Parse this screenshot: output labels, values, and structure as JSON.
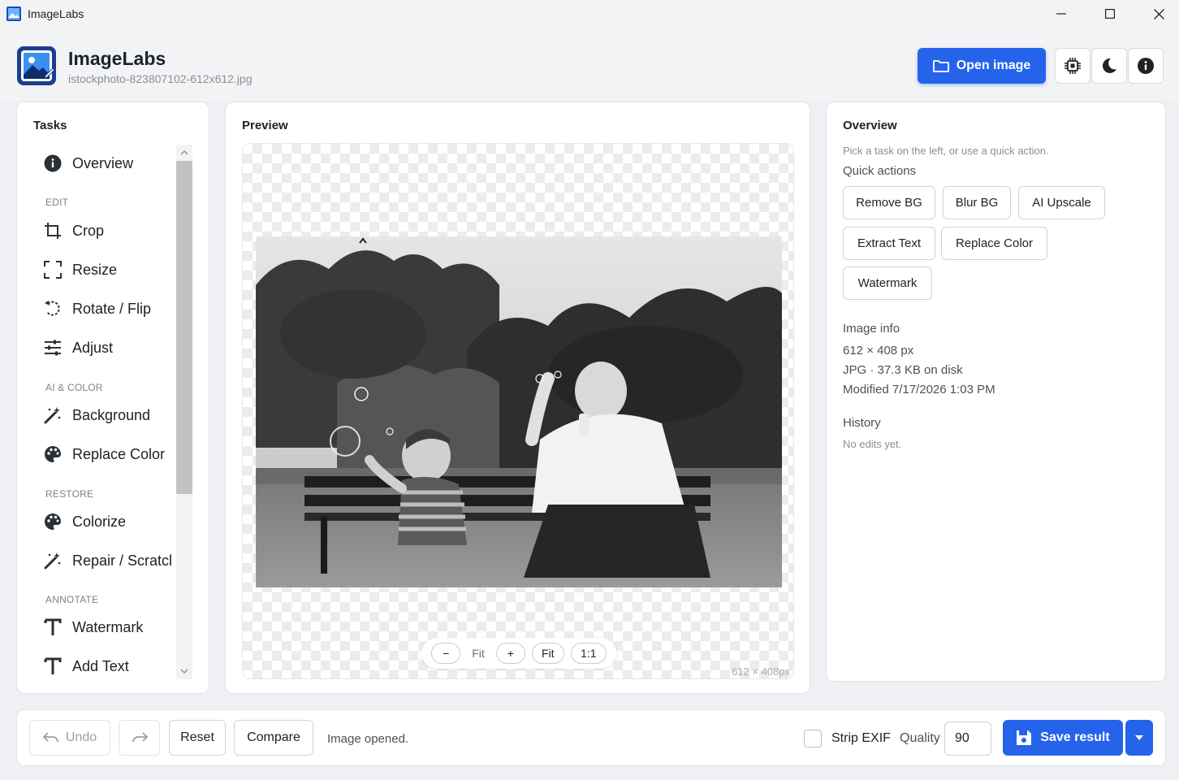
{
  "window": {
    "title": "ImageLabs",
    "controls": [
      "minimize-icon",
      "maximize-icon",
      "close-icon"
    ]
  },
  "header": {
    "app_name": "ImageLabs",
    "file_name": "istockphoto-823807102-612x612.jpg",
    "open_button": "Open image",
    "icon_buttons": [
      "cpu-icon",
      "dark-mode-icon",
      "info-icon"
    ],
    "accent_color": "#2563eb"
  },
  "tasks": {
    "title": "Tasks",
    "overview_item": {
      "label": "Overview",
      "icon": "info-icon"
    },
    "sections": [
      {
        "label": "EDIT",
        "items": [
          {
            "label": "Crop",
            "icon": "crop-icon"
          },
          {
            "label": "Resize",
            "icon": "resize-icon"
          },
          {
            "label": "Rotate / Flip",
            "icon": "rotate-icon"
          },
          {
            "label": "Adjust",
            "icon": "sliders-icon"
          }
        ]
      },
      {
        "label": "AI & COLOR",
        "items": [
          {
            "label": "Background",
            "icon": "magic-wand-icon"
          },
          {
            "label": "Replace Color",
            "icon": "palette-icon"
          }
        ]
      },
      {
        "label": "RESTORE",
        "items": [
          {
            "label": "Colorize",
            "icon": "palette-icon"
          },
          {
            "label": "Repair / Scratcl",
            "icon": "magic-wand-icon"
          }
        ]
      },
      {
        "label": "ANNOTATE",
        "items": [
          {
            "label": "Watermark",
            "icon": "text-icon"
          },
          {
            "label": "Add Text",
            "icon": "text-icon"
          }
        ]
      }
    ]
  },
  "preview": {
    "title": "Preview",
    "zoom": {
      "minus": "−",
      "label": "Fit",
      "plus": "+",
      "fit": "Fit",
      "one_to_one": "1:1"
    },
    "dimensions": "612 × 408px"
  },
  "overview": {
    "title": "Overview",
    "hint": "Pick a task on the left, or use a quick action.",
    "quick_actions_label": "Quick actions",
    "quick_actions": [
      "Remove BG",
      "Blur BG",
      "AI Upscale",
      "Extract Text",
      "Replace Color",
      "Watermark"
    ],
    "image_info_label": "Image info",
    "image_info": {
      "size": "612 × 408 px",
      "format": "JPG · 37.3 KB on disk",
      "modified": "Modified 7/17/2026 1:03 PM"
    },
    "history_label": "History",
    "history_empty": "No edits yet."
  },
  "footer": {
    "undo": "Undo",
    "reset": "Reset",
    "compare": "Compare",
    "status": "Image opened.",
    "strip_exif": "Strip EXIF",
    "strip_exif_checked": false,
    "quality_label": "Quality",
    "quality_value": "90",
    "save": "Save result"
  }
}
